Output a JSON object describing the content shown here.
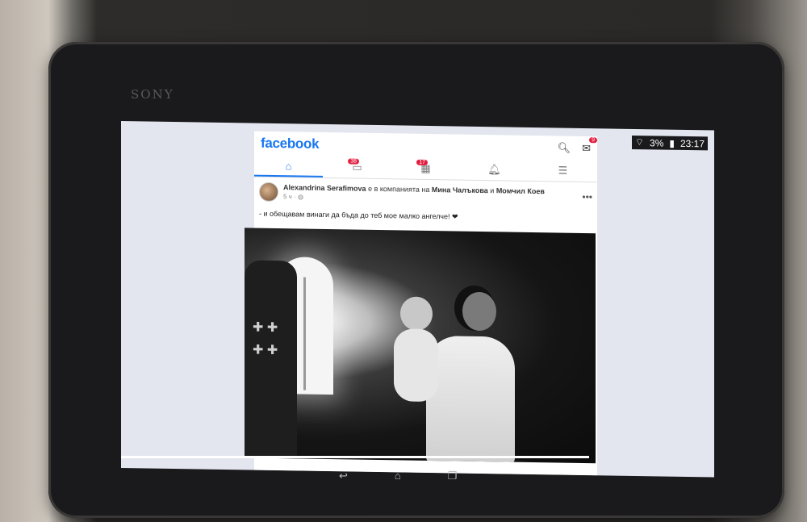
{
  "device": {
    "brand": "SONY"
  },
  "status_bar": {
    "battery": "3%",
    "time": "23:17",
    "left_icon": "screenshot-icon"
  },
  "facebook": {
    "logo": "facebook",
    "badges": {
      "messenger": "9",
      "videos": "38",
      "marketplace": "17"
    },
    "nav": [
      "home-icon",
      "video-icon",
      "marketplace-icon",
      "bell-icon",
      "menu-icon"
    ]
  },
  "post": {
    "author": "Alexandrina Serafimova",
    "with_text": "е в компанията на",
    "tagged_1": "Мина Чалъкова",
    "and_text": "и",
    "tagged_2": "Момчил Коев",
    "time": "5 ч ·",
    "caption": "- и обещавам винаги да бъда до теб мое малко ангелче! ❤"
  },
  "colors": {
    "accent": "#1877f2",
    "badge": "#e41e3f"
  }
}
